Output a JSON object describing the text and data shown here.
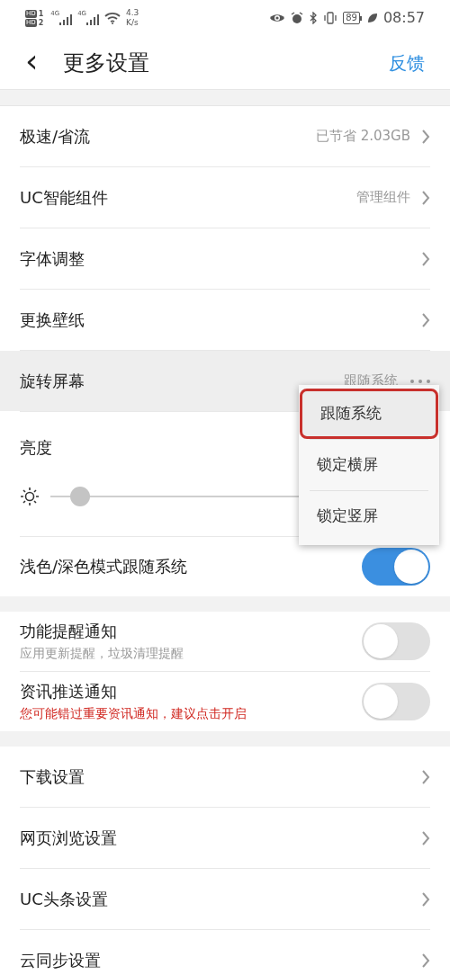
{
  "status_bar": {
    "sims": [
      {
        "badge": "HD",
        "slot": "1"
      },
      {
        "badge": "HD",
        "slot": "2"
      }
    ],
    "signals": [
      {
        "network": "4G"
      },
      {
        "network": "4G"
      }
    ],
    "speed_value": "4.3",
    "speed_unit": "K/s",
    "battery": "89",
    "time": "08:57"
  },
  "header": {
    "back": "‹",
    "title": "更多设置",
    "action": "反馈"
  },
  "sections": [
    {
      "rows": [
        {
          "kind": "link",
          "label": "极速/省流",
          "value": "已节省 2.03GB",
          "highlighted": false
        },
        {
          "kind": "link",
          "label": "UC智能组件",
          "value": "管理组件",
          "highlighted": false
        },
        {
          "kind": "link",
          "label": "字体调整",
          "highlighted": false
        },
        {
          "kind": "link",
          "label": "更换壁纸",
          "highlighted": false
        },
        {
          "kind": "more",
          "label": "旋转屏幕",
          "value": "跟随系统",
          "highlighted": true
        },
        {
          "kind": "slider",
          "label": "亮度",
          "level": 0.08,
          "highlighted": false
        },
        {
          "kind": "toggle",
          "label": "浅色/深色模式跟随系统",
          "on": true,
          "highlighted": false
        }
      ]
    },
    {
      "rows": [
        {
          "kind": "toggle",
          "label": "功能提醒通知",
          "hint": "应用更新提醒，垃圾清理提醒",
          "warning": false,
          "on": false,
          "highlighted": false
        },
        {
          "kind": "toggle",
          "label": "资讯推送通知",
          "hint": "您可能错过重要资讯通知，建议点击开启",
          "warning": true,
          "on": false,
          "highlighted": false
        }
      ]
    },
    {
      "rows": [
        {
          "kind": "link",
          "label": "下载设置",
          "highlighted": false
        },
        {
          "kind": "link",
          "label": "网页浏览设置",
          "highlighted": false
        },
        {
          "kind": "link",
          "label": "UC头条设置",
          "highlighted": false
        },
        {
          "kind": "link",
          "label": "云同步设置",
          "highlighted": false
        }
      ]
    }
  ],
  "popup_menu": {
    "items": [
      {
        "label": "跟随系统",
        "selected": true
      },
      {
        "label": "锁定横屏",
        "selected": false
      },
      {
        "label": "锁定竖屏",
        "selected": false
      }
    ]
  }
}
